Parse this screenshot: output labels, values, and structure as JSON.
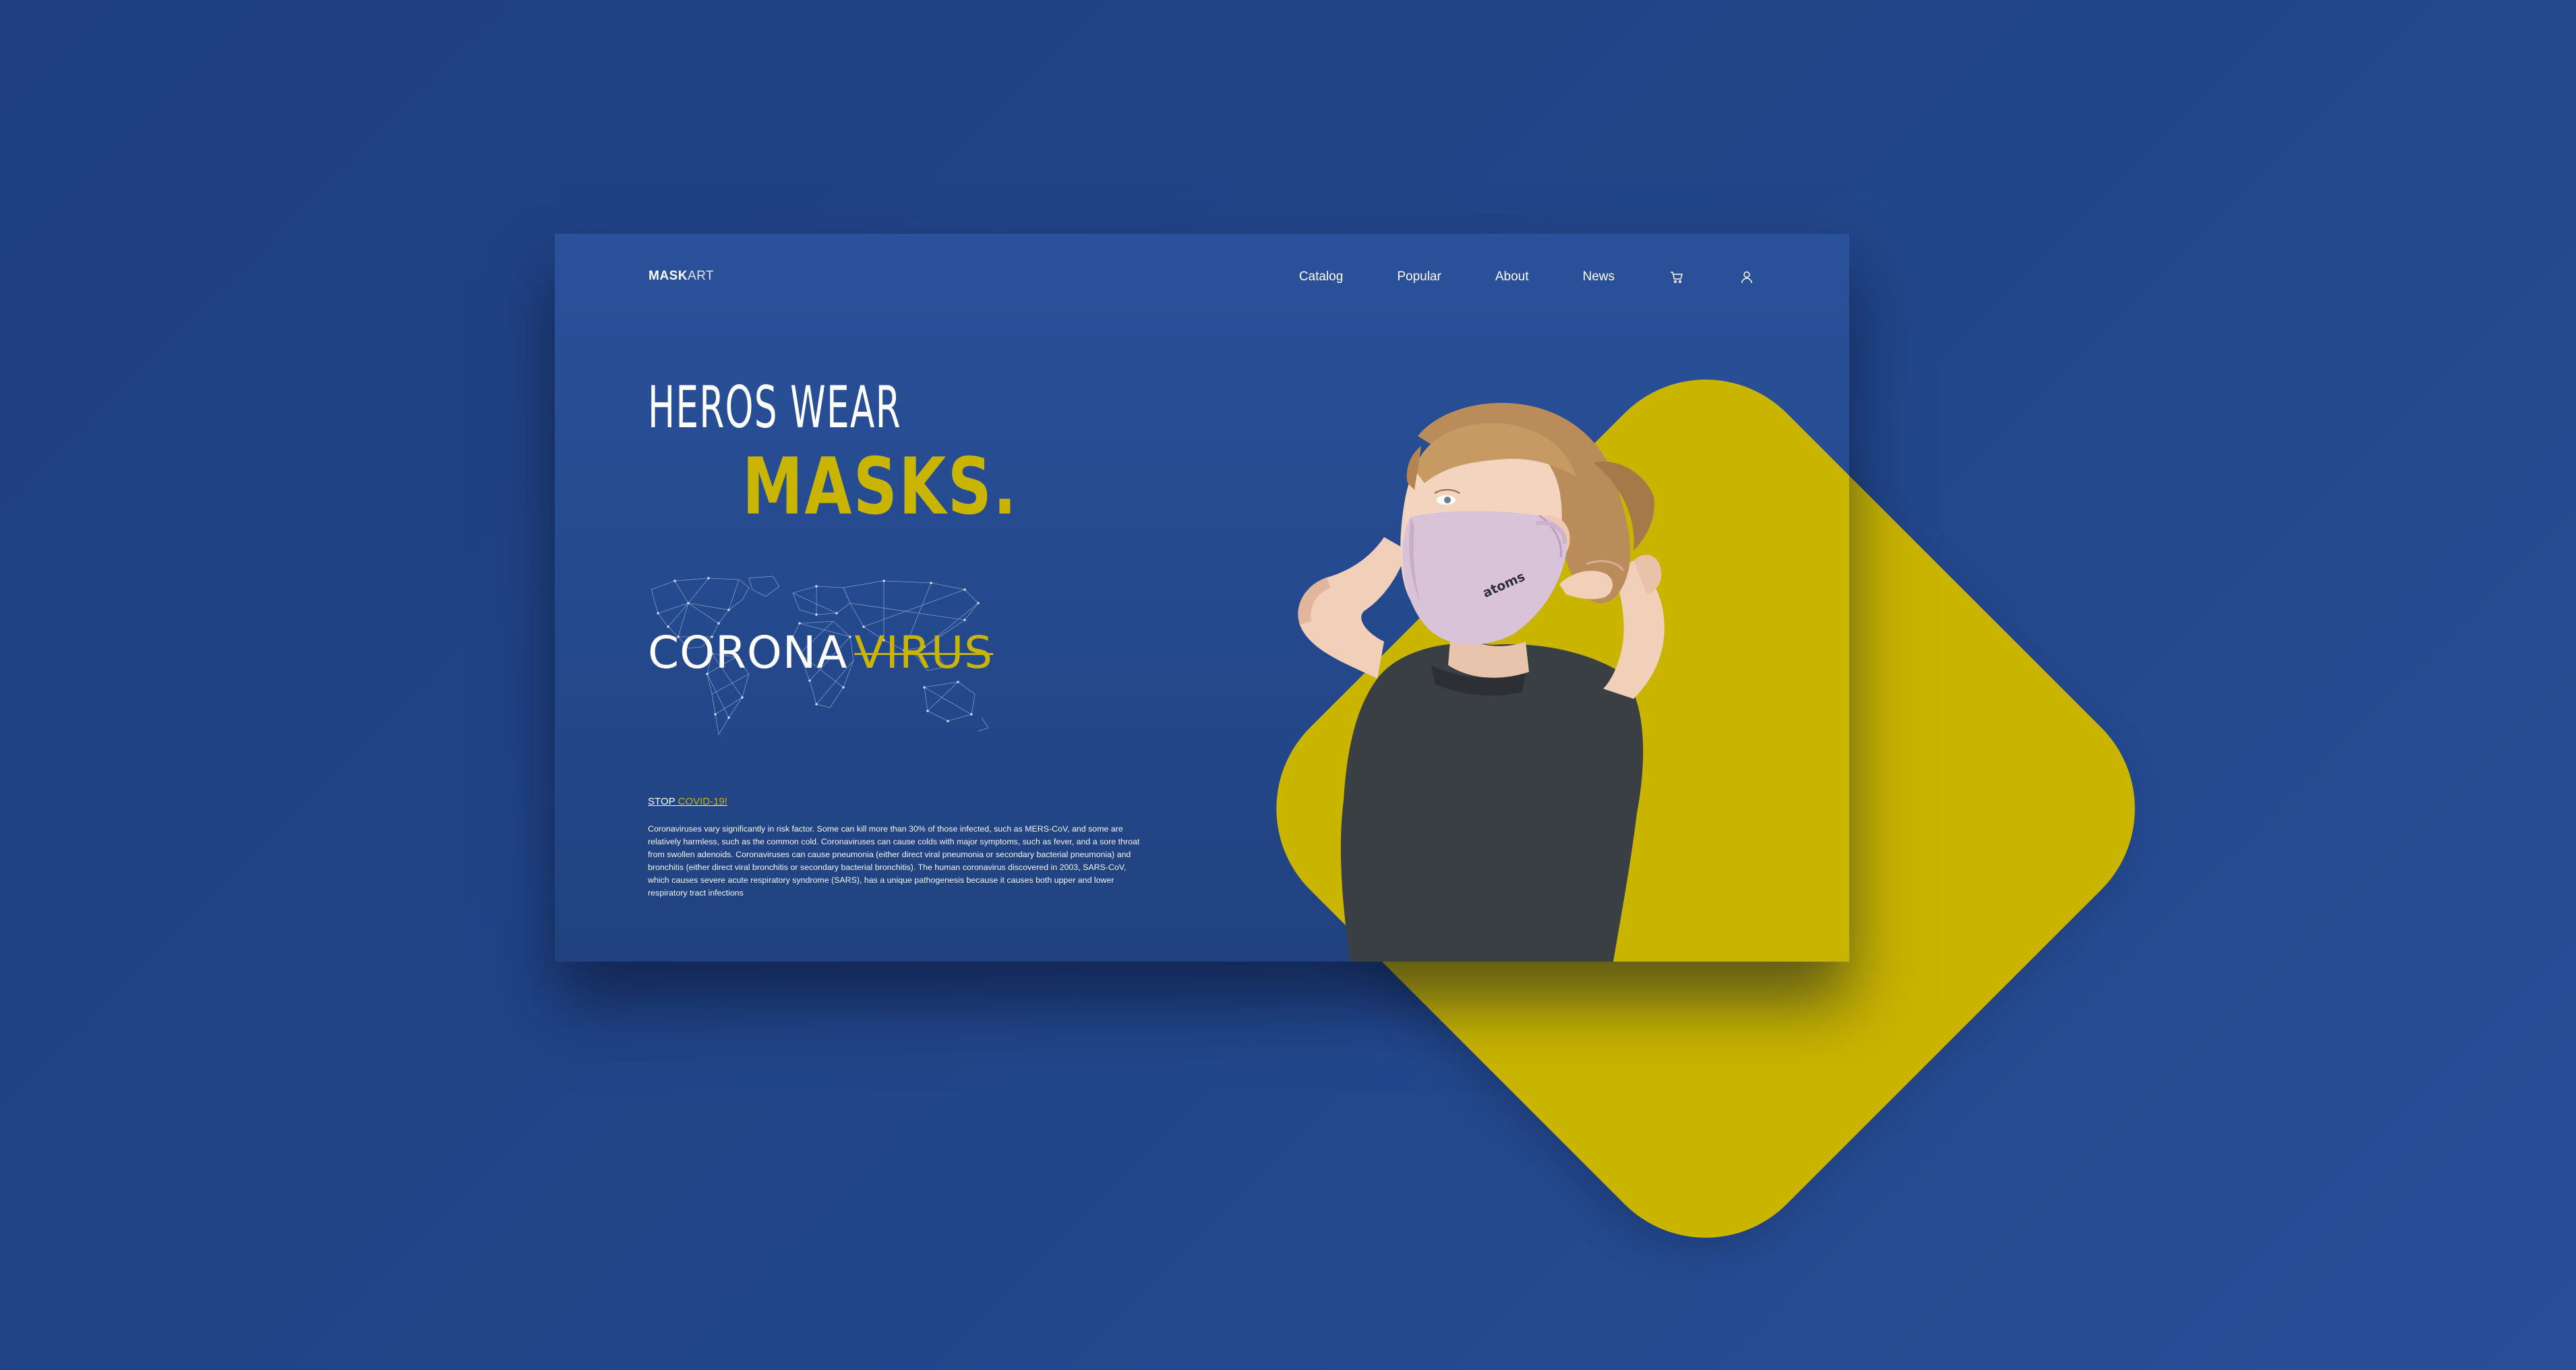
{
  "brand": {
    "name_bold": "MASK",
    "name_light": "ART"
  },
  "nav": {
    "links": [
      "Catalog",
      "Popular",
      "About",
      "News"
    ],
    "icons": [
      "cart-icon",
      "user-icon"
    ]
  },
  "hero": {
    "line1": "HEROS WEAR",
    "line2": "MASKS.",
    "corona_word": "CORONA",
    "virus_word": "VIRUS"
  },
  "info": {
    "stop_label": "STOP",
    "covid_label": "COVID-19!",
    "paragraph": "Coronaviruses vary significantly in risk factor. Some can kill more than 30% of those infected, such as MERS-CoV, and some are relatively harmless, such as the common cold. Coronaviruses can cause colds with major symptoms, such as fever, and a sore throat from swollen adenoids. Coronaviruses can cause pneumonia (either direct viral pneumonia or secondary bacterial pneumonia) and bronchitis (either direct viral bronchitis or secondary bacterial bronchitis). The human coronavirus discovered in 2003, SARS-CoV, which causes severe acute respiratory syndrome (SARS), has a unique pathogenesis because it causes both upper and lower respiratory tract infections"
  },
  "photo": {
    "mask_brand": "atoms"
  },
  "colors": {
    "background": "#22468a",
    "card": "#254a8f",
    "accent_yellow": "#c9b400",
    "text": "#ffffff"
  }
}
